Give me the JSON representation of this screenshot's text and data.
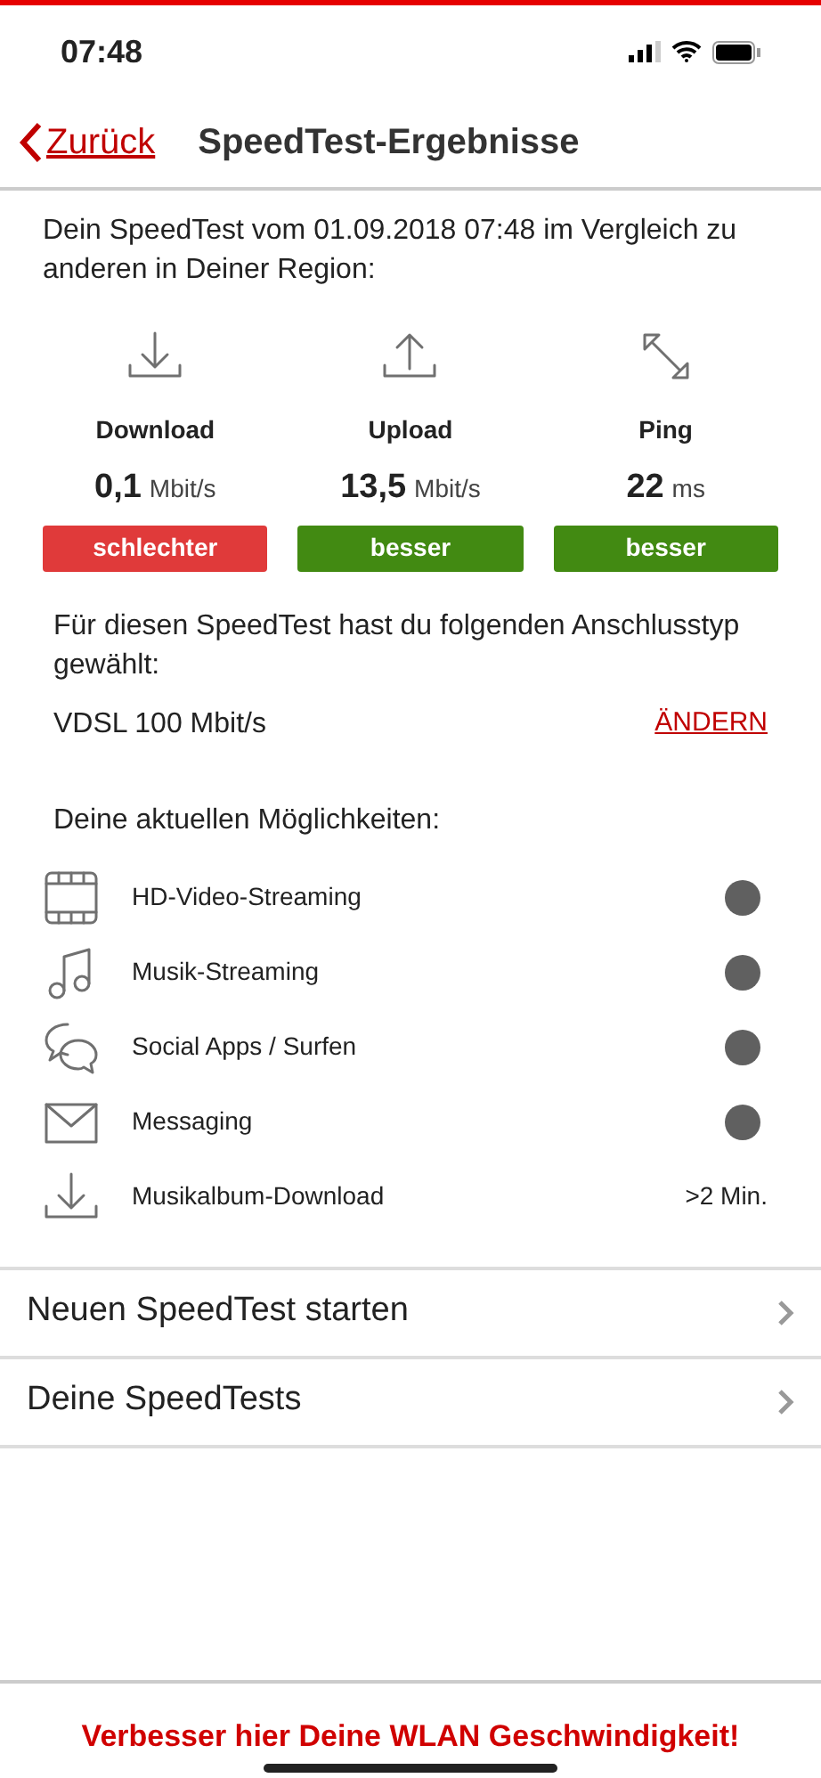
{
  "status_bar": {
    "time": "07:48"
  },
  "nav": {
    "back": "Zurück",
    "title": "SpeedTest-Ergebnisse"
  },
  "intro": "Dein SpeedTest vom 01.09.2018 07:48 im Vergleich zu anderen in Deiner Region:",
  "metrics": [
    {
      "label": "Download",
      "value": "0,1",
      "unit": "Mbit/s",
      "rating": "schlechter",
      "color": "#e03a3a"
    },
    {
      "label": "Upload",
      "value": "13,5",
      "unit": "Mbit/s",
      "rating": "besser",
      "color": "#428a12"
    },
    {
      "label": "Ping",
      "value": "22",
      "unit": "ms",
      "rating": "besser",
      "color": "#428a12"
    }
  ],
  "connection": {
    "text": "Für diesen SpeedTest hast du folgenden Anschlusstyp gewählt:",
    "type": "VDSL 100 Mbit/s",
    "change": "ÄNDERN"
  },
  "options_title": "Deine aktuellen Möglichkeiten:",
  "options": [
    {
      "label": "HD-Video-Streaming",
      "kind": "dot",
      "color": "#606060"
    },
    {
      "label": "Musik-Streaming",
      "kind": "dot",
      "color": "#606060"
    },
    {
      "label": "Social Apps / Surfen",
      "kind": "dot",
      "color": "#606060"
    },
    {
      "label": "Messaging",
      "kind": "dot",
      "color": "#606060"
    },
    {
      "label": "Musikalbum-Download",
      "kind": "text",
      "value": ">2 Min."
    }
  ],
  "menu": [
    "Neuen SpeedTest starten",
    "Deine SpeedTests"
  ],
  "footer": "Verbesser hier Deine WLAN Geschwindigkeit!"
}
